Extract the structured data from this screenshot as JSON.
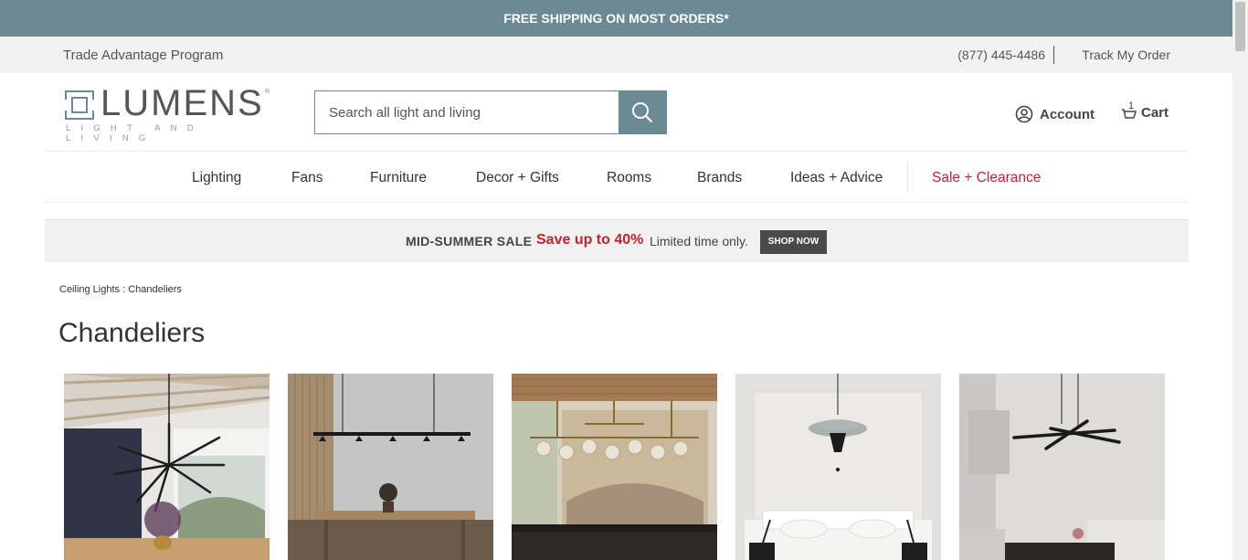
{
  "promo": {
    "text": "FREE SHIPPING ON MOST ORDERS*"
  },
  "utility": {
    "trade_program": "Trade Advantage Program",
    "phone": "(877) 445-4486",
    "track_order": "Track My Order"
  },
  "logo": {
    "word": "LUMENS",
    "tagline": "LIGHT AND LIVING",
    "tm": "®"
  },
  "search": {
    "placeholder": "Search all light and living",
    "icon": "search-icon"
  },
  "account": {
    "label": "Account",
    "icon": "user-icon"
  },
  "cart": {
    "label": "Cart",
    "count": "1",
    "icon": "cart-icon"
  },
  "nav": {
    "items": [
      "Lighting",
      "Fans",
      "Furniture",
      "Decor + Gifts",
      "Rooms",
      "Brands",
      "Ideas + Advice"
    ],
    "sale": "Sale + Clearance"
  },
  "banner": {
    "event": "MID-SUMMER SALE",
    "offer": "Save up to 40%",
    "note": "Limited time only.",
    "cta": "SHOP NOW"
  },
  "breadcrumb": {
    "parent": "Ceiling Lights",
    "separator": ":",
    "current": "Chandeliers"
  },
  "page_title": "Chandeliers",
  "colors": {
    "brand_teal": "#6b8a93",
    "sale_red": "#c8202f",
    "cta_dark": "#4a4a4a"
  }
}
